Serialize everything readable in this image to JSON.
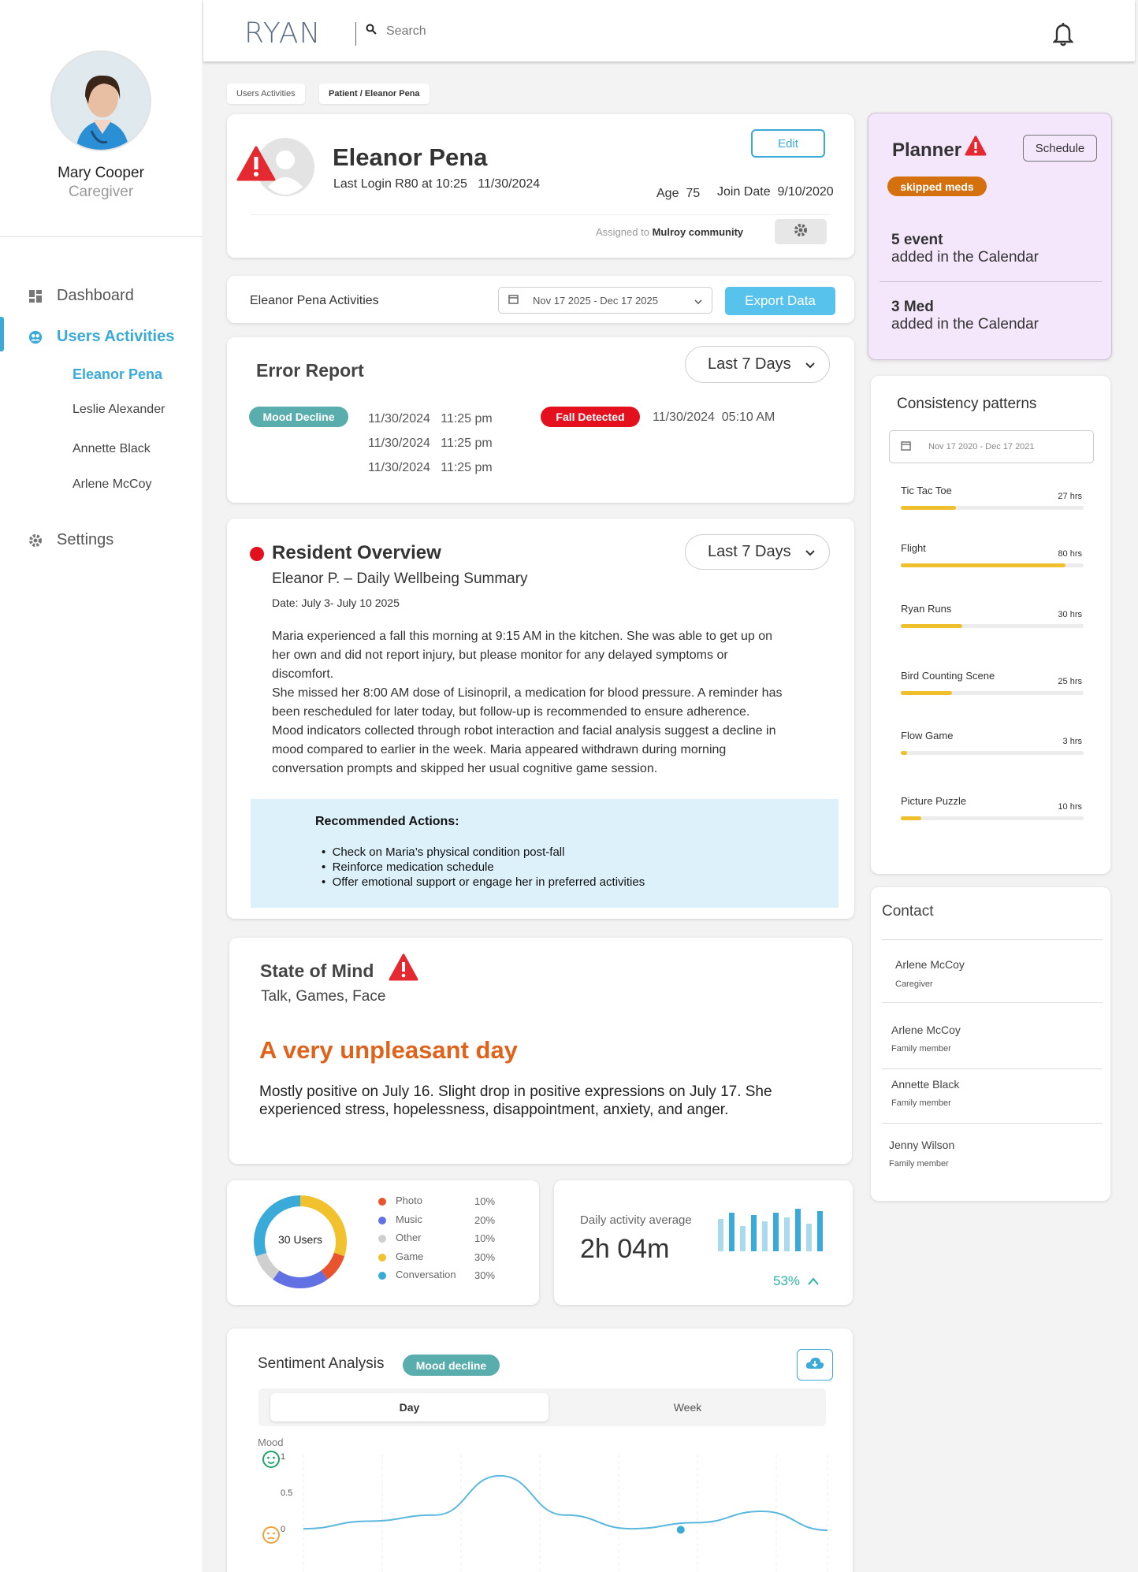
{
  "sidebar": {
    "user_name": "Mary Cooper",
    "user_role": "Caregiver",
    "nav": [
      {
        "label": "Dashboard",
        "icon": "dashboard-icon"
      },
      {
        "label": "Users Activities",
        "icon": "users-icon"
      },
      {
        "label": "Settings",
        "icon": "gear-icon"
      }
    ],
    "patients": [
      "Eleanor Pena",
      "Leslie Alexander",
      "Annette Black",
      "Arlene McCoy"
    ]
  },
  "header": {
    "logo": "RYAN",
    "search_placeholder": "Search",
    "bell_icon": "bell-icon"
  },
  "breadcrumb": [
    "Users Activities",
    "Patient / Eleanor Pena"
  ],
  "patient": {
    "name": "Eleanor Pena",
    "last_login": "Last Login R80 at 10:25   11/30/2024",
    "edit_label": "Edit",
    "age_label": "Age",
    "age": "75",
    "join_label": "Join Date",
    "join_date": "9/10/2020",
    "assigned_prefix": "Assigned to",
    "assigned_to": "Mulroy community"
  },
  "activities_bar": {
    "title": "Eleanor Pena Activities",
    "date_range": "Nov 17 2025 - Dec 17 2025",
    "export_label": "Export Data"
  },
  "error_report": {
    "title": "Error Report",
    "range": "Last 7 Days",
    "mood_tag": "Mood Decline",
    "mood_entries": [
      "11/30/2024   11:25 pm",
      "11/30/2024   11:25 pm",
      "11/30/2024   11:25 pm"
    ],
    "fall_tag": "Fall Detected",
    "fall_entry": "11/30/2024  05:10 AM"
  },
  "overview": {
    "title": "Resident Overview",
    "range": "Last 7 Days",
    "subtitle": "Eleanor P. – Daily Wellbeing Summary",
    "date": "Date: July 3- July 10 2025",
    "lines": [
      "Maria experienced a fall this morning at 9:15 AM in the kitchen. She was able to get up on",
      "her own and did not report injury, but please monitor for any delayed symptoms or",
      "discomfort.",
      "She missed her 8:00 AM dose of Lisinopril, a medication for blood pressure. A reminder has",
      "been rescheduled for later today, but follow-up is recommended to ensure adherence.",
      "Mood indicators collected through robot interaction and facial analysis suggest a decline in",
      "mood compared to earlier in the week. Maria appeared withdrawn during morning",
      "conversation prompts and skipped her usual cognitive game session."
    ],
    "actions_title": "Recommended Actions:",
    "actions": [
      "Check on Maria’s physical condition post-fall",
      "Reinforce medication schedule",
      "Offer emotional support or engage her in preferred activities"
    ]
  },
  "state_of_mind": {
    "title": "State of Mind",
    "subtitle": "Talk, Games, Face",
    "headline": "A very unpleasant day",
    "line1": "Mostly positive on July 16. Slight drop in positive expressions on July 17. She",
    "line2": "experienced stress, hopelessness, disappointment, anxiety, and anger."
  },
  "usage": {
    "center_label": "30 Users",
    "items": [
      {
        "label": "Photo",
        "pct": "10%",
        "value": 10,
        "color": "#e8542e"
      },
      {
        "label": "Music",
        "pct": "20%",
        "value": 20,
        "color": "#6170e2"
      },
      {
        "label": "Other",
        "pct": "10%",
        "value": 10,
        "color": "#cfcfcf"
      },
      {
        "label": "Game",
        "pct": "30%",
        "value": 30,
        "color": "#f2c12e"
      },
      {
        "label": "Conversation",
        "pct": "30%",
        "value": 30,
        "color": "#3aaad8"
      }
    ]
  },
  "daily": {
    "label": "Daily activity average",
    "value": "2h 04m",
    "change": "53%",
    "bars": [
      0.75,
      0.9,
      0.6,
      0.85,
      0.7,
      0.9,
      0.8,
      1.0,
      0.65,
      0.95
    ]
  },
  "planner": {
    "title": "Planner",
    "schedule_label": "Schedule",
    "tag": "skipped meds",
    "items": [
      {
        "count": "5 event",
        "desc": "added in the Calendar"
      },
      {
        "count": "3 Med",
        "desc": "added in the Calendar"
      }
    ]
  },
  "consistency": {
    "title": "Consistency patterns",
    "date_range": "Nov 17 2020 - Dec 17 2021",
    "max_hrs": 80,
    "items": [
      {
        "name": "Tic Tac Toe",
        "hrs_label": "27 hrs",
        "hrs": 27
      },
      {
        "name": "Flight",
        "hrs_label": "80 hrs",
        "hrs": 80
      },
      {
        "name": "Ryan Runs",
        "hrs_label": "30 hrs",
        "hrs": 30
      },
      {
        "name": "Bird Counting Scene",
        "hrs_label": "25 hrs",
        "hrs": 25
      },
      {
        "name": "Flow Game",
        "hrs_label": "3 hrs",
        "hrs": 3
      },
      {
        "name": "Picture Puzzle",
        "hrs_label": "10 hrs",
        "hrs": 10
      }
    ]
  },
  "contact": {
    "title": "Contact",
    "people": [
      {
        "name": "Arlene McCoy",
        "role": "Caregiver"
      },
      {
        "name": "Arlene McCoy",
        "role": "Family member"
      },
      {
        "name": "Annette Black",
        "role": "Family member"
      },
      {
        "name": "Jenny Wilson",
        "role": "Family member"
      }
    ]
  },
  "sentiment": {
    "title": "Sentiment Analysis",
    "tag": "Mood decline",
    "tabs": [
      "Day",
      "Week"
    ],
    "active_tab": "Day",
    "y_label": "Mood",
    "y_ticks": [
      "1",
      "0.5",
      "0"
    ]
  },
  "chart_data": {
    "type": "line",
    "ylabel": "Mood",
    "ylim": [
      0,
      1
    ],
    "series": [
      {
        "values": [
          0.02,
          0.12,
          0.2,
          0.72,
          0.2,
          0.02,
          0.1,
          0.25,
          0.0
        ]
      }
    ]
  },
  "colors": {
    "accent": "#3aaad8",
    "alert": "#e52930",
    "teal": "#5aadad",
    "orange": "#e0631c"
  }
}
